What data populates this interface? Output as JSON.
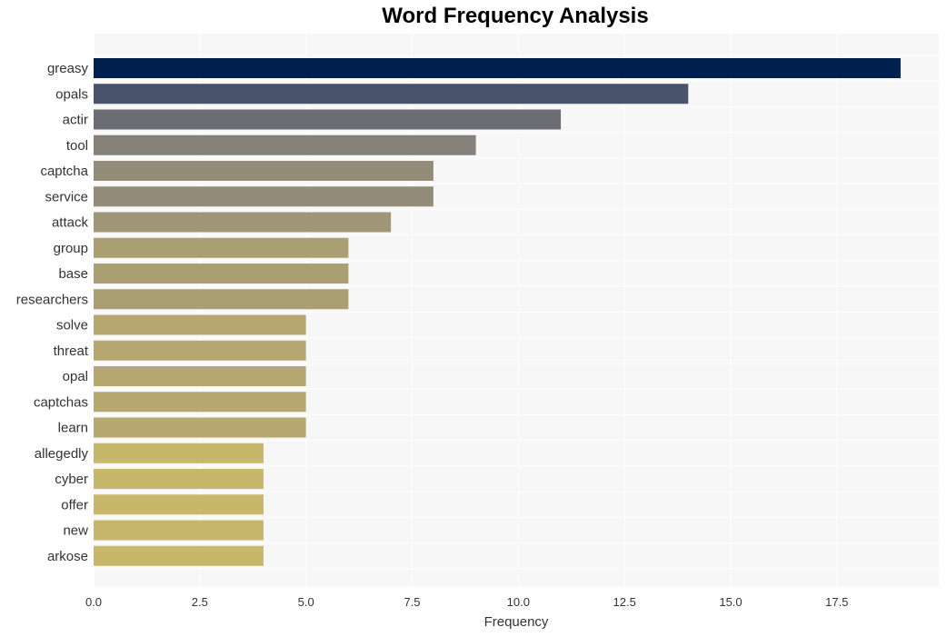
{
  "chart_data": {
    "type": "bar",
    "orientation": "horizontal",
    "title": "Word Frequency Analysis",
    "xlabel": "Frequency",
    "ylabel": "",
    "xlim": [
      0,
      19.9
    ],
    "xticks": [
      0.0,
      2.5,
      5.0,
      7.5,
      10.0,
      12.5,
      15.0,
      17.5
    ],
    "xtick_labels": [
      "0.0",
      "2.5",
      "5.0",
      "7.5",
      "10.0",
      "12.5",
      "15.0",
      "17.5"
    ],
    "grid": true,
    "categories": [
      "greasy",
      "opals",
      "actir",
      "tool",
      "captcha",
      "service",
      "attack",
      "group",
      "base",
      "researchers",
      "solve",
      "threat",
      "opal",
      "captchas",
      "learn",
      "allegedly",
      "cyber",
      "offer",
      "new",
      "arkose"
    ],
    "values": [
      19,
      14,
      11,
      9,
      8,
      8,
      7,
      6,
      6,
      6,
      5,
      5,
      5,
      5,
      5,
      4,
      4,
      4,
      4,
      4
    ],
    "colors": [
      "#00204e",
      "#49526b",
      "#6c6c73",
      "#85817a",
      "#928c79",
      "#928c79",
      "#9e9677",
      "#aa9e73",
      "#aa9e73",
      "#aa9e73",
      "#b7a770",
      "#b7a770",
      "#b7a770",
      "#b7a770",
      "#b7a770",
      "#c7b76b",
      "#c7b76b",
      "#c7b76b",
      "#c7b76b",
      "#c7b76b"
    ],
    "plot_background": "#f7f7f7",
    "grid_color": "#ffffff"
  }
}
